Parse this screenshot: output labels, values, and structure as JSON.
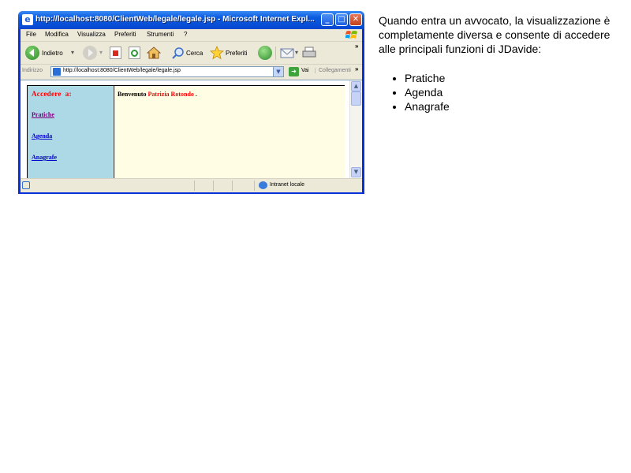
{
  "window": {
    "title": "http://localhost:8080/ClientWeb/legale/legale.jsp - Microsoft Internet Expl...",
    "minimize_glyph": "_",
    "maximize_glyph": "□",
    "close_glyph": "✕"
  },
  "menu": [
    "File",
    "Modifica",
    "Visualizza",
    "Preferiti",
    "Strumenti",
    "?"
  ],
  "toolbar": {
    "back_label": "Indietro",
    "search_label": "Cerca",
    "favorites_label": "Preferiti",
    "overflow": "»"
  },
  "address_bar": {
    "label": "Indirizzo",
    "url": "http://localhost:8080/ClientWeb/legale/legale.jsp",
    "go_label": "Vai",
    "links_label": "Collegamenti",
    "overflow": "»"
  },
  "page": {
    "nav_heading": "Accedere  a:",
    "nav_links": [
      "Pratiche",
      "Agenda",
      "Anagrafe"
    ],
    "welcome_prefix": "Benvenuto ",
    "user_name": "Patrizia Rotondo",
    "welcome_suffix": " ."
  },
  "status_bar": {
    "zone": "Intranet locale"
  },
  "colors": {
    "nav_background": "#add8e6",
    "content_background": "#fffde3",
    "accent_red": "#ff0000",
    "link_blue": "#0000cc",
    "link_visited": "#800080"
  },
  "description": {
    "text": "Quando entra un avvocato, la visualizzazione è completamente diversa e consente di accedere alle principali funzioni di JDavide:",
    "items": [
      "Pratiche",
      "Agenda",
      "Anagrafe"
    ]
  }
}
